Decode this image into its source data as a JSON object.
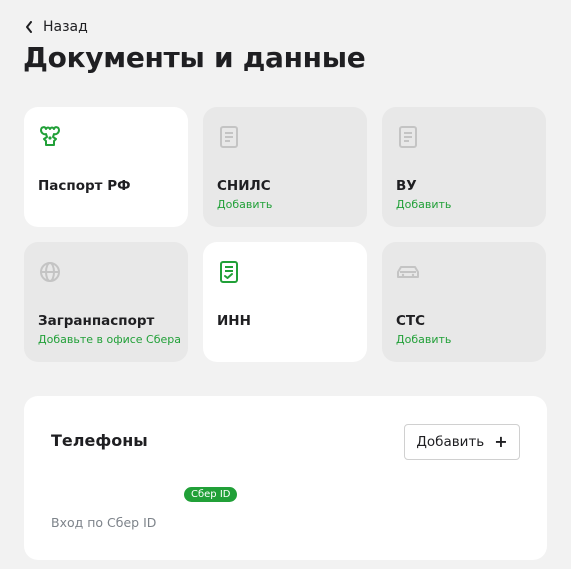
{
  "header": {
    "back_label": "Назад",
    "title": "Документы и данные"
  },
  "documents": [
    {
      "name": "Паспорт РФ",
      "action": "",
      "icon": "passport-emblem-icon"
    },
    {
      "name": "СНИЛС",
      "action": "Добавить",
      "icon": "document-icon"
    },
    {
      "name": "ВУ",
      "action": "Добавить",
      "icon": "document-icon"
    },
    {
      "name": "Загранпаспорт",
      "action": "Добавьте в офисе Сбера",
      "icon": "globe-icon"
    },
    {
      "name": "ИНН",
      "action": "",
      "icon": "document-check-icon"
    },
    {
      "name": "СТС",
      "action": "Добавить",
      "icon": "car-icon"
    }
  ],
  "phones": {
    "title": "Телефоны",
    "add_label": "Добавить",
    "badge": "Сбер ID",
    "login_label": "Вход по Сбер ID"
  },
  "colors": {
    "accent": "#21a038",
    "background": "#f2f2f2",
    "card": "#ffffff",
    "card_muted": "#e8e8e8",
    "icon_muted": "#c4c4c4"
  }
}
